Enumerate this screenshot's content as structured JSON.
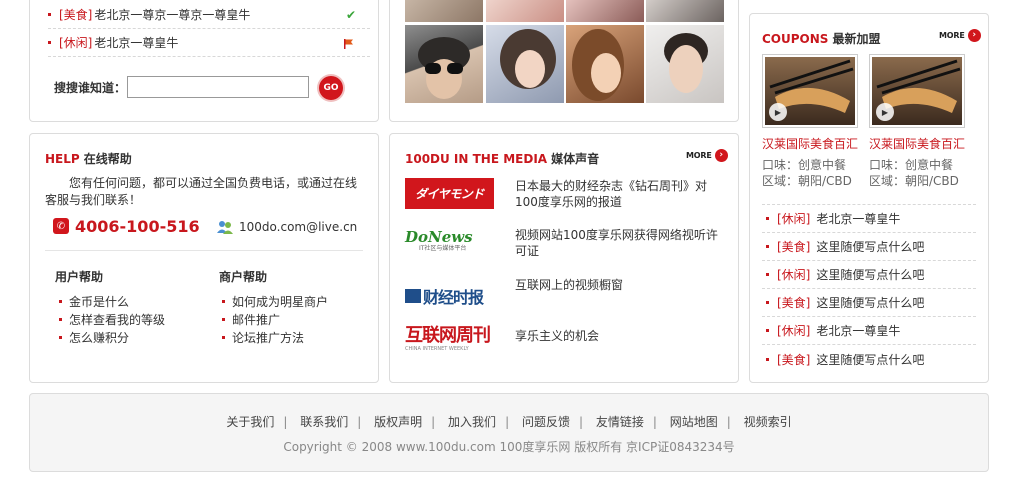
{
  "top_list": {
    "items": [
      {
        "cat": "[美食]",
        "text": "老北京一尊京一尊京一尊皇牛"
      },
      {
        "cat": "[休闲]",
        "text": "老北京一尊皇牛"
      }
    ]
  },
  "search": {
    "label": "搜搜谁知道：",
    "value": "",
    "placeholder": "",
    "go_label": "GO"
  },
  "help": {
    "title_en": "HELP",
    "title_cn": "在线帮助",
    "intro": "您有任何问题，都可以通过全国负费电话，或通过在线客服与我们联系！",
    "phone": "4006-100-516",
    "email": "100do.com@live.cn",
    "user_help_title": "用户帮助",
    "user_help": [
      "金币是什么",
      "怎样查看我的等级",
      "怎么赚积分"
    ],
    "merchant_help_title": "商户帮助",
    "merchant_help": [
      "如何成为明星商户",
      "邮件推广",
      "论坛推广方法"
    ]
  },
  "media": {
    "title_en": "100DU IN THE MEDIA",
    "title_cn": "媒体声音",
    "more": "MORE",
    "items": [
      {
        "logo": "ダイヤモンド",
        "text": "日本最大的财经杂志《钻石周刊》对100度享乐网的报道"
      },
      {
        "logo": "DoNews",
        "logo_sub": "IT社区与媒体平台",
        "text": "视频网站100度享乐网获得网络视听许可证"
      },
      {
        "logo": "财经时报",
        "text": "互联网上的视频橱窗"
      },
      {
        "logo": "互联网周刊",
        "logo_sub": "CHINA INTERNET WEEKLY",
        "text": "享乐主义的机会"
      }
    ]
  },
  "coupons": {
    "title_en": "COUPONS",
    "title_cn": "最新加盟",
    "more": "MORE",
    "cards": [
      {
        "name": "汉莱国际美食百汇",
        "taste": "口味：创意中餐",
        "area": "区域：朝阳/CBD"
      },
      {
        "name": "汉莱国际美食百汇",
        "taste": "口味：创意中餐",
        "area": "区域：朝阳/CBD"
      }
    ],
    "list": [
      {
        "cat": "[休闲]",
        "text": "老北京一尊皇牛"
      },
      {
        "cat": "[美食]",
        "text": "这里随便写点什么吧"
      },
      {
        "cat": "[休闲]",
        "text": "这里随便写点什么吧"
      },
      {
        "cat": "[美食]",
        "text": "这里随便写点什么吧"
      },
      {
        "cat": "[休闲]",
        "text": "老北京一尊皇牛"
      },
      {
        "cat": "[美食]",
        "text": "这里随便写点什么吧"
      }
    ]
  },
  "footer": {
    "links": [
      "关于我们",
      "联系我们",
      "版权声明",
      "加入我们",
      "问题反馈",
      "友情链接",
      "网站地图",
      "视频索引"
    ],
    "copyright": "Copyright © 2008 www.100du.com 100度享乐网 版权所有   京ICP证0843234号"
  },
  "colors": {
    "accent": "#c8171d",
    "border": "#dcdcdc",
    "footer_bg": "#f5f5f5"
  }
}
